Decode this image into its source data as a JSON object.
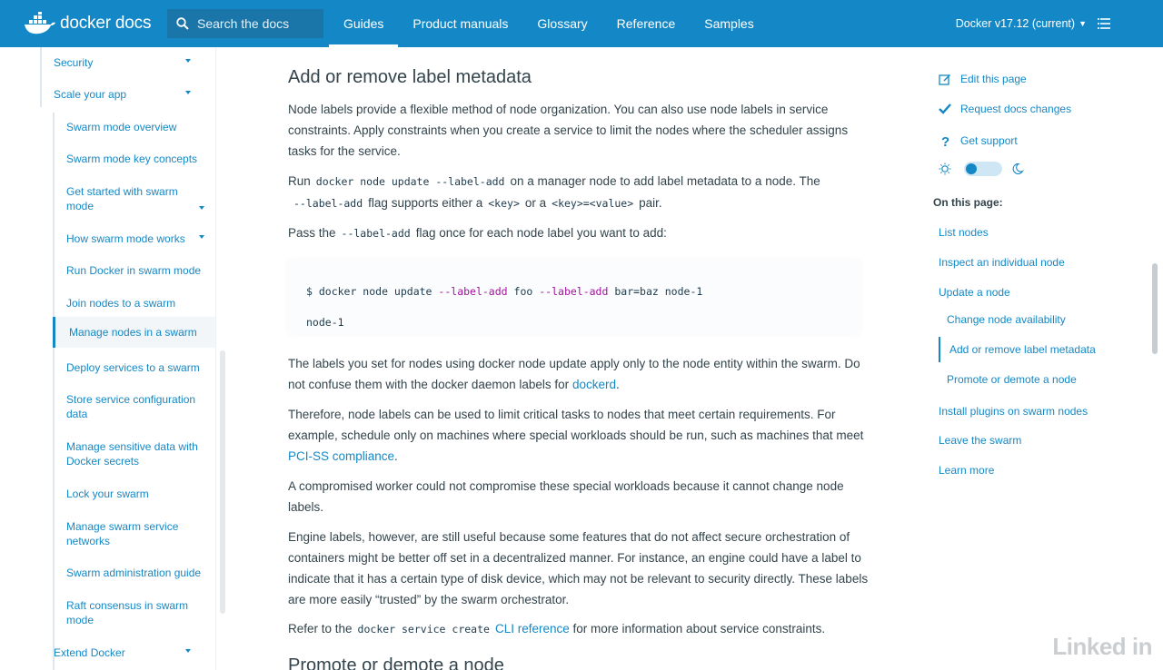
{
  "header": {
    "brand": "docker docs",
    "search_placeholder": "Search the docs",
    "nav": [
      "Guides",
      "Product manuals",
      "Glossary",
      "Reference",
      "Samples"
    ],
    "active_nav": "Guides",
    "version": "Docker v17.12 (current)"
  },
  "sidebar": {
    "items": [
      {
        "label": "Security",
        "level": 1,
        "expandable": true
      },
      {
        "label": "Scale your app",
        "level": 1,
        "expandable": true
      },
      {
        "label": "Swarm mode overview",
        "level": 2
      },
      {
        "label": "Swarm mode key concepts",
        "level": 2
      },
      {
        "label": "Get started with swarm mode",
        "level": 2,
        "expandable": true
      },
      {
        "label": "How swarm mode works",
        "level": 2,
        "expandable": true
      },
      {
        "label": "Run Docker in swarm mode",
        "level": 2
      },
      {
        "label": "Join nodes to a swarm",
        "level": 2
      },
      {
        "label": "Manage nodes in a swarm",
        "level": 2,
        "active": true
      },
      {
        "label": "Deploy services to a swarm",
        "level": 2
      },
      {
        "label": "Store service configuration data",
        "level": 2
      },
      {
        "label": "Manage sensitive data with Docker secrets",
        "level": 2
      },
      {
        "label": "Lock your swarm",
        "level": 2
      },
      {
        "label": "Manage swarm service networks",
        "level": 2
      },
      {
        "label": "Swarm administration guide",
        "level": 2
      },
      {
        "label": "Raft consensus in swarm mode",
        "level": 2
      },
      {
        "label": "Extend Docker",
        "level": 1,
        "expandable": true
      }
    ]
  },
  "content": {
    "title": "Add or remove label metadata",
    "p1": "Node labels provide a flexible method of node organization. You can also use node labels in service constraints. Apply constraints when you create a service to limit the nodes where the scheduler assigns tasks for the service.",
    "p2": {
      "a": "Run",
      "code1": "docker node update --label-add",
      "b": "on a manager node to add label metadata to a node. The",
      "code2": "--label-add",
      "c": "flag supports either a",
      "code3": "<key>",
      "d": "or a",
      "code4": "<key>=<value>",
      "e": "pair."
    },
    "p3": {
      "a": "Pass the",
      "code": "--label-add",
      "b": "flag once for each node label you want to add:"
    },
    "code": {
      "prompt": "$ docker node update",
      "flag1": "--label-add",
      "arg1": "foo",
      "flag2": "--label-add",
      "arg2": "bar=baz node-1",
      "output": "node-1"
    },
    "p4": {
      "a": "The labels you set for nodes using docker node update apply only to the node entity within the swarm. Do not confuse them with the docker daemon labels for",
      "link": "dockerd",
      "b": "."
    },
    "p5": {
      "a": "Therefore, node labels can be used to limit critical tasks to nodes that meet certain requirements. For example, schedule only on machines where special workloads should be run, such as machines that meet",
      "link": "PCI-SS compliance",
      "b": "."
    },
    "p6": "A compromised worker could not compromise these special workloads because it cannot change node labels.",
    "p7": "Engine labels, however, are still useful because some features that do not affect secure orchestration of containers might be better off set in a decentralized manner. For instance, an engine could have a label to indicate that it has a certain type of disk device, which may not be relevant to security directly. These labels are more easily “trusted” by the swarm orchestrator.",
    "p8": {
      "a": "Refer to the",
      "code": "docker service create",
      "link": "CLI reference",
      "b": "for more information about service constraints."
    },
    "next_title": "Promote or demote a node"
  },
  "rail": {
    "edit": "Edit this page",
    "request": "Request docs changes",
    "support": "Get support",
    "on_this_page": "On this page:",
    "toc": [
      {
        "label": "List nodes",
        "level": 1
      },
      {
        "label": "Inspect an individual node",
        "level": 1
      },
      {
        "label": "Update a node",
        "level": 1
      },
      {
        "label": "Change node availability",
        "level": 2
      },
      {
        "label": "Add or remove label metadata",
        "level": 2,
        "active": true
      },
      {
        "label": "Promote or demote a node",
        "level": 2
      },
      {
        "label": "Install plugins on swarm nodes",
        "level": 1
      },
      {
        "label": "Leave the swarm",
        "level": 1
      },
      {
        "label": "Learn more",
        "level": 1
      }
    ]
  },
  "watermark": "Linked in",
  "colors": {
    "brand_blue": "#1488c6",
    "text": "#33444c",
    "code_flag": "#a0139e"
  }
}
